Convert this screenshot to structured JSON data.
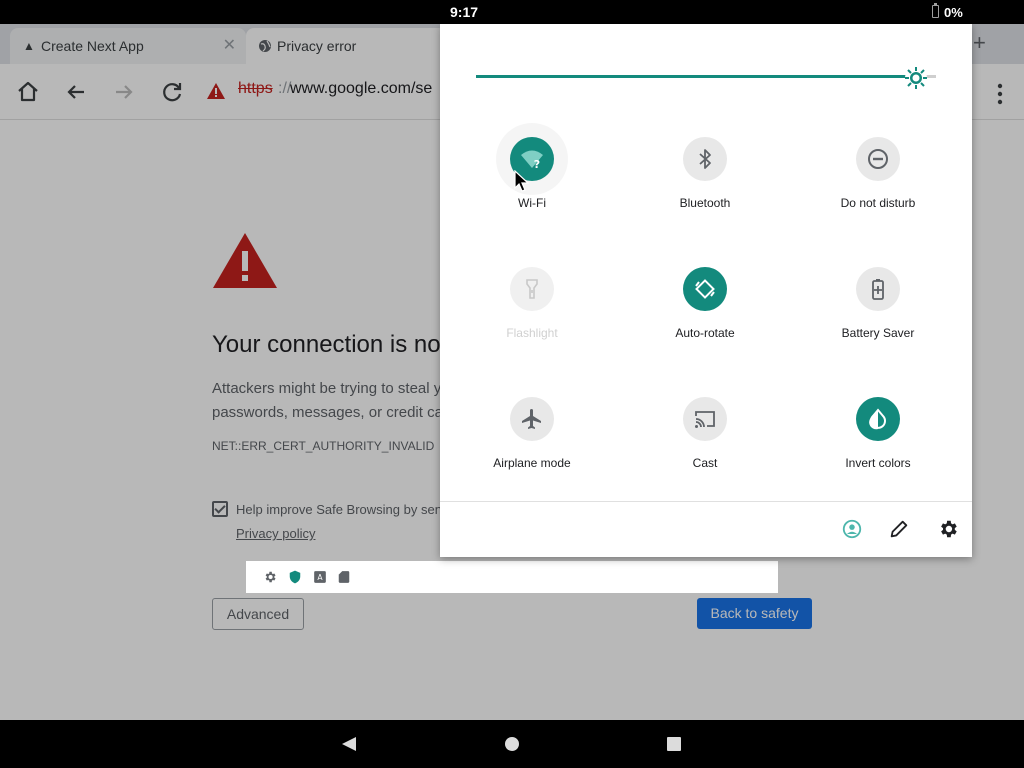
{
  "status_bar": {
    "time": "9:17",
    "battery": "0%"
  },
  "browser": {
    "tabs": [
      {
        "title": "Create Next App",
        "icon": "triangle-logo-icon"
      },
      {
        "title": "Privacy error",
        "icon": "globe-icon"
      }
    ],
    "url": {
      "scheme": "https",
      "separator": "://",
      "host": "www.google.com/se"
    },
    "page": {
      "heading": "Your connection is no",
      "body_line1": "Attackers might be trying to steal y",
      "body_line2": "passwords, messages, or credit ca",
      "error_code": "NET::ERR_CERT_AUTHORITY_INVALID",
      "safe_browsing_label": "Help improve Safe Browsing by sen",
      "privacy_policy": "Privacy policy",
      "advanced_button": "Advanced",
      "back_button": "Back to safety"
    }
  },
  "quick_settings": {
    "brightness_level": 0.95,
    "tiles": [
      {
        "label": "Wi-Fi",
        "icon": "wifi-question-icon",
        "state": "on"
      },
      {
        "label": "Bluetooth",
        "icon": "bluetooth-icon",
        "state": "off"
      },
      {
        "label": "Do not disturb",
        "icon": "do-not-disturb-icon",
        "state": "off"
      },
      {
        "label": "Flashlight",
        "icon": "flashlight-icon",
        "state": "unavailable"
      },
      {
        "label": "Auto-rotate",
        "icon": "auto-rotate-icon",
        "state": "on"
      },
      {
        "label": "Battery Saver",
        "icon": "battery-saver-icon",
        "state": "off"
      },
      {
        "label": "Airplane mode",
        "icon": "airplane-icon",
        "state": "off"
      },
      {
        "label": "Cast",
        "icon": "cast-icon",
        "state": "off"
      },
      {
        "label": "Invert colors",
        "icon": "invert-colors-icon",
        "state": "on"
      }
    ],
    "footer_icons": [
      "user-icon",
      "edit-icon",
      "settings-icon"
    ]
  },
  "notification_icons": [
    "settings-icon",
    "shield-icon",
    "keyboard-icon",
    "sd-card-icon"
  ],
  "colors": {
    "accent": "#138a7d",
    "link_blue": "#1a73e8",
    "error_red": "#c5221f"
  }
}
